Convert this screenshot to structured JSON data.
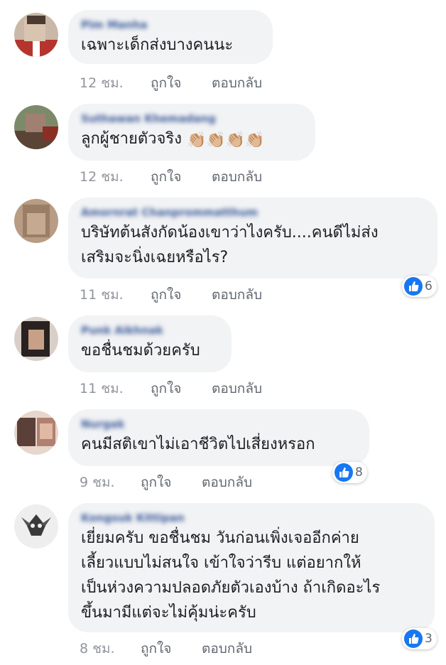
{
  "comments": [
    {
      "author": "Pim Manha",
      "text": "เฉพาะเด็กส่งบางคนนะ",
      "time": "12 ชม.",
      "like": "ถูกใจ",
      "reply": "ตอบกลับ"
    },
    {
      "author": "Suthawan Khemadang",
      "text": "ลูกผู้ชายตัวจริง",
      "emoji": "👏🏼👏🏼👏🏼👏🏼",
      "time": "12 ชม.",
      "like": "ถูกใจ",
      "reply": "ตอบกลับ"
    },
    {
      "author": "Amornrat Chanprommatthum",
      "text_line1": "บริษัทต้นสังกัดน้องเขาว่าไงครับ....คนดีไม่ส่ง",
      "text_line2": "เสริมจะนิ่งเฉยหรือไร?",
      "time": "11 ชม.",
      "like": "ถูกใจ",
      "reply": "ตอบกลับ",
      "reactions": "6"
    },
    {
      "author": "Punk Aikhnak",
      "text": "ขอชื่นชมด้วยครับ",
      "time": "11 ชม.",
      "like": "ถูกใจ",
      "reply": "ตอบกลับ"
    },
    {
      "author": "Nurgak",
      "text": "คนมีสติเขาไม่เอาชีวิตไปเสี่ยงหรอก",
      "time": "9 ชม.",
      "like": "ถูกใจ",
      "reply": "ตอบกลับ",
      "reactions": "8"
    },
    {
      "author": "Kongsuk Kittipan",
      "text_line1": "เยี่ยมครับ ขอชื่นชม วันก่อนเพิ่งเจออีกค่าย",
      "text_line2": "เลี้ยวแบบไม่สนใจ เข้าใจว่ารีบ แต่อยากให้",
      "text_line3": "เป็นห่วงความปลอดภัยตัวเองบ้าง ถ้าเกิดอะไร",
      "text_line4": "ขึ้นมามีแต่จะไม่คุ้มน่ะครับ",
      "time": "8 ชม.",
      "like": "ถูกใจ",
      "reply": "ตอบกลับ",
      "reactions": "3"
    }
  ],
  "colors": {
    "bubble": "#f2f3f5",
    "author": "#385898",
    "meta": "#90949c",
    "like_badge": "#1877f2"
  },
  "icons": {
    "reaction": "like-thumb-icon",
    "clap": "clapping-hands-icon"
  }
}
